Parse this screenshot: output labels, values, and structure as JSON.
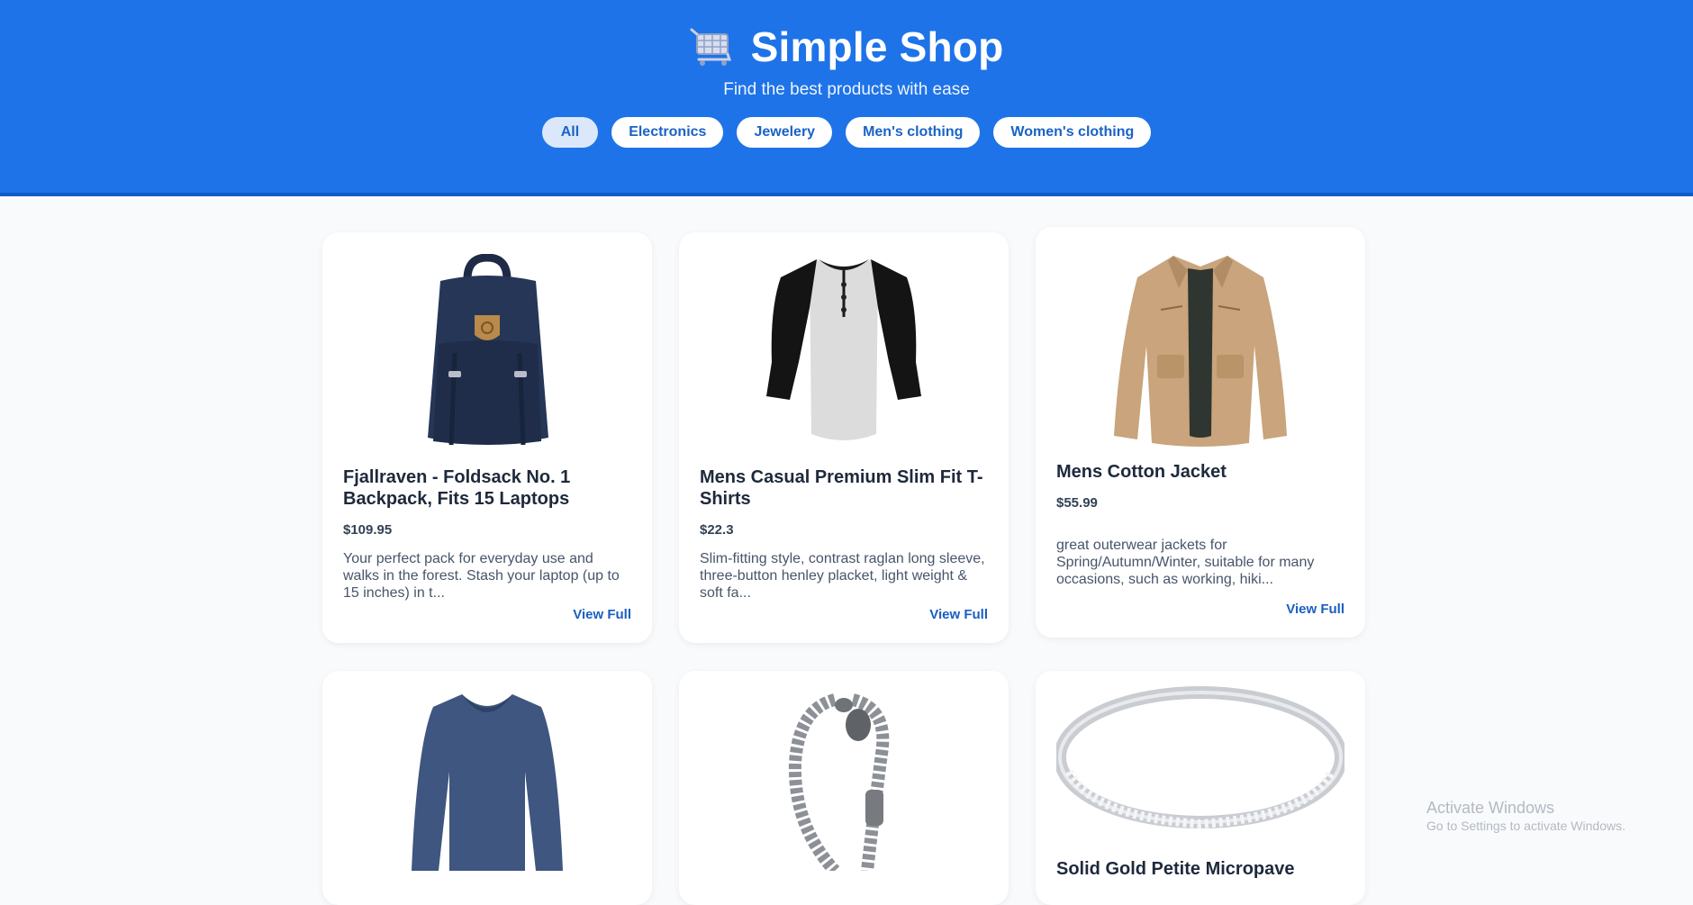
{
  "header": {
    "title": "Simple Shop",
    "subtitle": "Find the best products with ease",
    "cart_icon": "shopping-cart-icon",
    "brand_color": "#1e73e8",
    "filters": [
      "All",
      "Electronics",
      "Jewelery",
      "Men's clothing",
      "Women's clothing"
    ],
    "active_filter": "All"
  },
  "products": [
    {
      "name": "Fjallraven - Foldsack No. 1 Backpack, Fits 15 Laptops",
      "price": "$109.95",
      "description": "Your perfect pack for everyday use and walks in the forest. Stash your laptop (up to 15 inches) in t...",
      "cta": "View Full",
      "image": "backpack"
    },
    {
      "name": "Mens Casual Premium Slim Fit T-Shirts",
      "price": "$22.3",
      "description": "Slim-fitting style, contrast raglan long sleeve, three-button henley placket, light weight & soft fa...",
      "cta": "View Full",
      "image": "raglan-tshirt"
    },
    {
      "name": "Mens Cotton Jacket",
      "price": "$55.99",
      "description": "great outerwear jackets for Spring/Autumn/Winter, suitable for many occasions, such as working, hiki...",
      "cta": "View Full",
      "image": "cotton-jacket"
    },
    {
      "name": "",
      "image": "long-sleeve-shirt"
    },
    {
      "name": "",
      "image": "chain-bracelet"
    },
    {
      "name": "Solid Gold Petite Micropave",
      "image": "silver-ring"
    }
  ],
  "watermark": {
    "line1": "Activate Windows",
    "line2": "Go to Settings to activate Windows."
  }
}
